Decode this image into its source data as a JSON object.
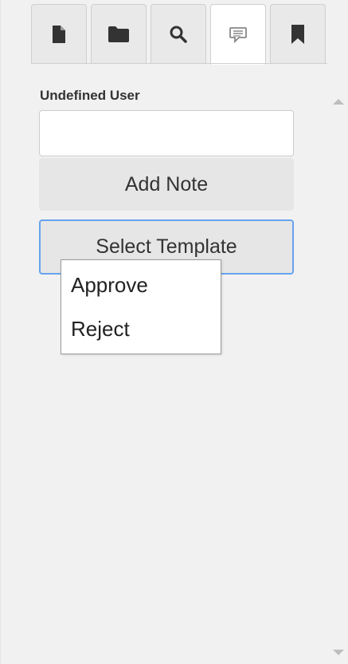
{
  "tabs": [
    {
      "icon": "document-icon",
      "active": false
    },
    {
      "icon": "folder-icon",
      "active": false
    },
    {
      "icon": "search-icon",
      "active": false
    },
    {
      "icon": "comment-icon",
      "active": true
    },
    {
      "icon": "bookmark-icon",
      "active": false
    }
  ],
  "notes": {
    "user_label": "Undefined User",
    "input_value": "",
    "add_note_label": "Add Note",
    "select_template_label": "Select Template"
  },
  "template_menu": {
    "items": [
      "Approve",
      "Reject"
    ]
  },
  "colors": {
    "focus_border": "#66a3ee",
    "icon": "#333333",
    "active_icon": "#888888"
  }
}
